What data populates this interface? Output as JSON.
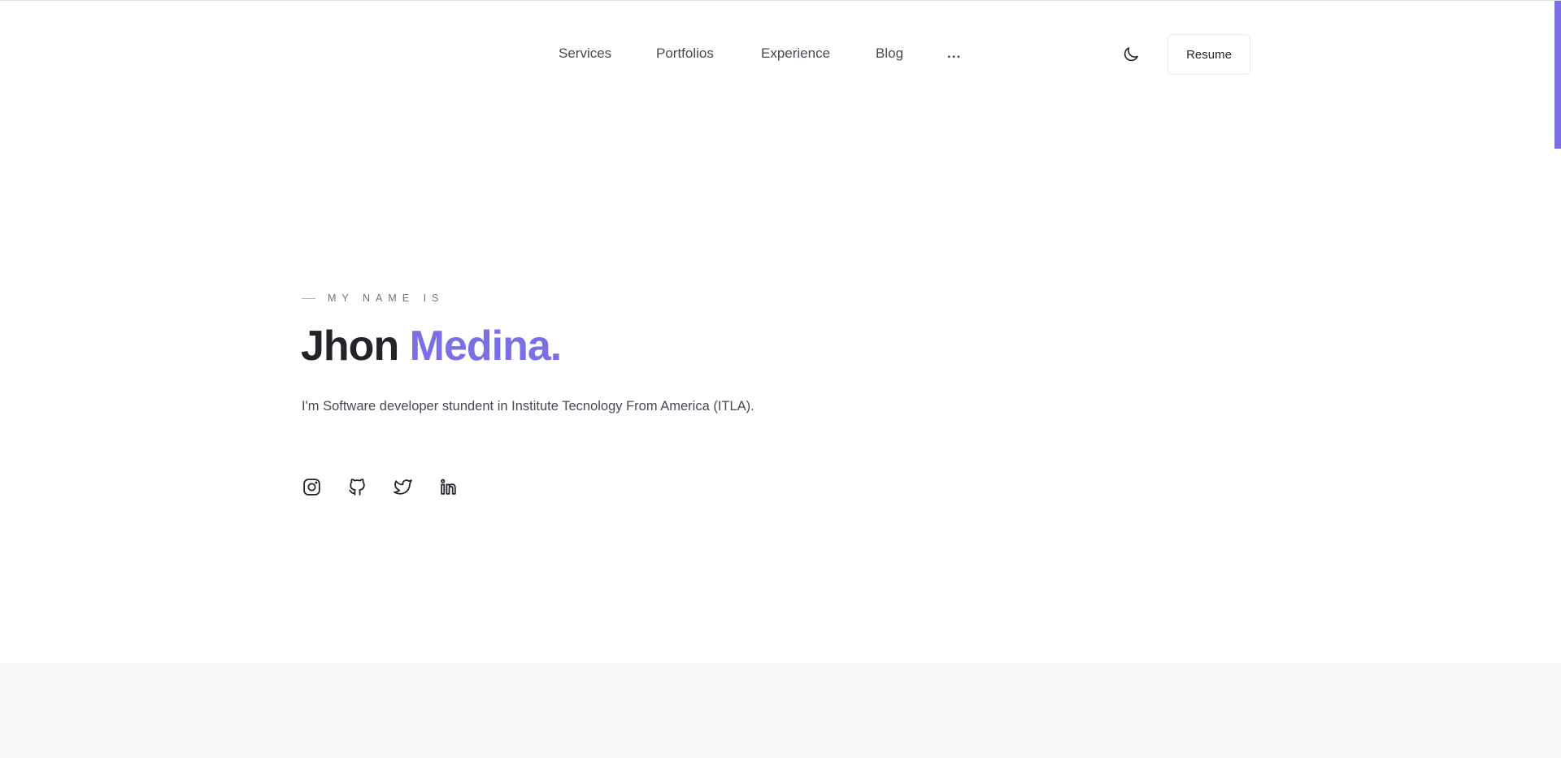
{
  "nav": {
    "items": [
      {
        "label": "Services"
      },
      {
        "label": "Portfolios"
      },
      {
        "label": "Experience"
      },
      {
        "label": "Blog"
      },
      {
        "label": "..."
      }
    ]
  },
  "header": {
    "theme_toggle_icon": "moon-icon",
    "resume_label": "Resume"
  },
  "hero": {
    "eyebrow": "MY NAME IS",
    "first_name": "Jhon",
    "last_name": "Medina.",
    "description": "I'm Software developer stundent in Institute Tecnology From America (ITLA).",
    "social_icons": [
      "instagram-icon",
      "github-icon",
      "twitter-icon",
      "linkedin-icon"
    ]
  },
  "colors": {
    "accent": "#7c6fe5",
    "text": "#212529",
    "muted": "#6c757d",
    "section_bg": "#f9f9fa"
  }
}
